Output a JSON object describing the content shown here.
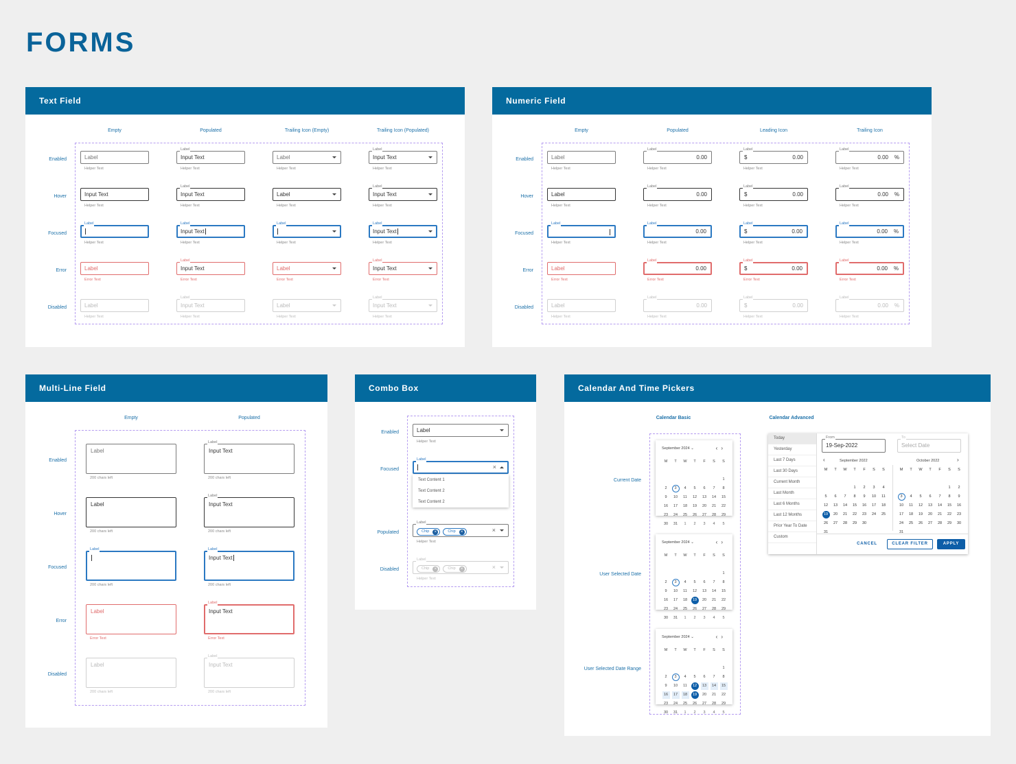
{
  "page_title": "FORMS",
  "colors": {
    "header": "#046a9e",
    "accent": "#2a78c2",
    "error": "#e06b6b",
    "selected": "#0d5ea8"
  },
  "states": [
    "Enabled",
    "Hover",
    "Focused",
    "Error",
    "Disabled"
  ],
  "text_field": {
    "title": "Text Field",
    "columns": [
      "Empty",
      "Populated",
      "Trailing Icon (Empty)",
      "Trailing Icon (Populated)"
    ],
    "label": "Label",
    "input": "Input Text",
    "helper": "Helper Text",
    "error": "Error Text"
  },
  "numeric_field": {
    "title": "Numeric Field",
    "columns": [
      "Empty",
      "Populated",
      "Leading Icon",
      "Trailing Icon"
    ],
    "label": "Label",
    "value": "0.00",
    "helper": "Helper Text",
    "error": "Error Text",
    "currency": "$",
    "percent": "%"
  },
  "multi_line": {
    "title": "Multi-Line Field",
    "columns": [
      "Empty",
      "Populated"
    ],
    "label": "Label",
    "input": "Input Text",
    "counter": "200 chars left",
    "error": "Error Text"
  },
  "combo_box": {
    "title": "Combo Box",
    "rows": [
      "Enabled",
      "Focused",
      "Populated",
      "Disabled"
    ],
    "label": "Label",
    "helper": "Helper Text",
    "options": [
      "Text Content 1",
      "Text Content 2",
      "Text Content 2"
    ],
    "chip": "Chip",
    "clear_icon": "×"
  },
  "calendar": {
    "title": "Calendar And Time Pickers",
    "basic_title": "Calendar Basic",
    "advanced_title": "Calendar Advanced",
    "rows": [
      "Current Date",
      "User Selected Date",
      "User Selected Date Range"
    ],
    "month": "September 2024",
    "weekdays": [
      "M",
      "T",
      "W",
      "T",
      "F",
      "S",
      "S"
    ],
    "days": [
      "",
      "",
      "",
      "",
      "",
      "",
      "1",
      "2",
      "3",
      "4",
      "5",
      "6",
      "7",
      "8",
      "9",
      "10",
      "11",
      "12",
      "13",
      "14",
      "15",
      "16",
      "17",
      "18",
      "19",
      "20",
      "21",
      "22",
      "23",
      "24",
      "25",
      "26",
      "27",
      "28",
      "29",
      "30",
      "31",
      "1",
      "2",
      "3",
      "4",
      "5"
    ],
    "today": "3",
    "selected": "19",
    "range_start": "12",
    "range_end": "19",
    "advanced": {
      "quick": [
        "Today",
        "Yesterday",
        "Last 7 Days",
        "Last 30 Days",
        "Current Month",
        "Last Month",
        "Last 6 Months",
        "Last 12 Months",
        "Prior Year To Date",
        "Custom"
      ],
      "from_label": "From",
      "from_value": "19-Sep-2022",
      "to_label": "To",
      "to_placeholder": "Select Date",
      "month1": "September 2022",
      "month2": "October 2022",
      "days1": [
        "",
        "",
        "",
        "1",
        "2",
        "3",
        "4",
        "5",
        "6",
        "7",
        "8",
        "9",
        "10",
        "11",
        "12",
        "13",
        "14",
        "15",
        "16",
        "17",
        "18",
        "19",
        "20",
        "21",
        "22",
        "23",
        "24",
        "25",
        "26",
        "27",
        "28",
        "29",
        "30",
        "",
        "",
        "31"
      ],
      "days2": [
        "",
        "",
        "",
        "",
        "",
        "1",
        "2",
        "3",
        "4",
        "5",
        "6",
        "7",
        "8",
        "9",
        "10",
        "11",
        "12",
        "13",
        "14",
        "15",
        "16",
        "17",
        "18",
        "19",
        "20",
        "21",
        "22",
        "23",
        "24",
        "25",
        "26",
        "27",
        "28",
        "29",
        "30",
        "31"
      ],
      "cancel": "CANCEL",
      "clear": "CLEAR FILTER",
      "apply": "APPLY"
    }
  }
}
